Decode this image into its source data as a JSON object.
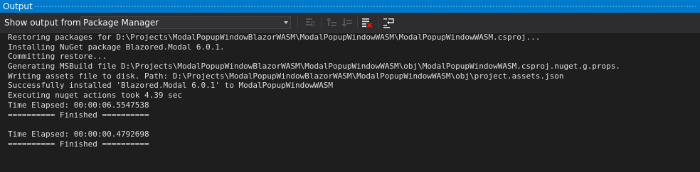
{
  "window": {
    "title": "Output"
  },
  "toolbar": {
    "show_output_label": "Show output from:",
    "source_selected": "Package Manager",
    "buttons": [
      {
        "name": "go-to-previous-message-icon",
        "enabled": false
      },
      {
        "name": "go-to-next-message-icon",
        "enabled": false
      },
      {
        "name": "find-message-icon",
        "enabled": false
      },
      {
        "name": "clear-all-icon",
        "enabled": true
      },
      {
        "name": "toggle-word-wrap-icon",
        "enabled": true
      }
    ]
  },
  "output": {
    "lines": [
      "Restoring packages for D:\\Projects\\ModalPopupWindowBlazorWASM\\ModalPopupWindowWASM\\ModalPopupWindowWASM.csproj...",
      "Installing NuGet package Blazored.Modal 6.0.1.",
      "Committing restore...",
      "Generating MSBuild file D:\\Projects\\ModalPopupWindowBlazorWASM\\ModalPopupWindowWASM\\obj\\ModalPopupWindowWASM.csproj.nuget.g.props.",
      "Writing assets file to disk. Path: D:\\Projects\\ModalPopupWindowBlazorWASM\\ModalPopupWindowWASM\\obj\\project.assets.json",
      "Successfully installed 'Blazored.Modal 6.0.1' to ModalPopupWindowWASM",
      "Executing nuget actions took 4.39 sec",
      "Time Elapsed: 00:00:06.5547538",
      "========== Finished ==========",
      "",
      "Time Elapsed: 00:00:00.4792698",
      "========== Finished =========="
    ]
  },
  "colors": {
    "title_bar": "#007acc",
    "toolbar_bg": "#2d2d30",
    "editor_bg": "#1e1e1e",
    "text": "#dcdcdc",
    "clear_icon_red": "#e51400"
  }
}
